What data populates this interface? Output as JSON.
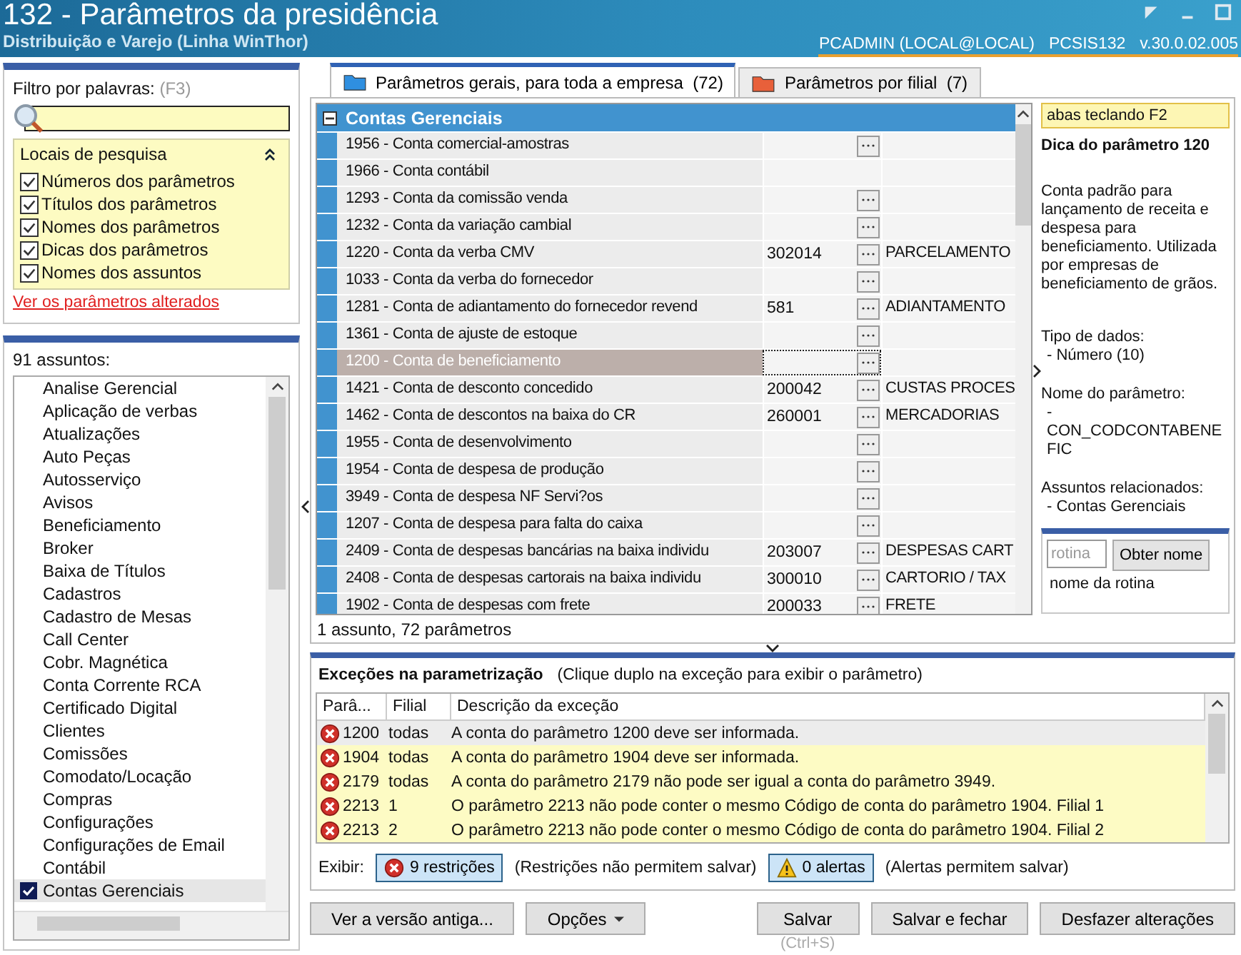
{
  "window": {
    "title": "132 - Parâmetros da presidência",
    "subtitle": "Distribuição e Varejo (Linha WinThor)",
    "user": "PCADMIN (LOCAL@LOCAL)",
    "program": "PCSIS132",
    "version": "v.30.0.02.005"
  },
  "filter": {
    "label": "Filtro por palavras:",
    "shortcut": "(F3)",
    "places": {
      "title": "Locais de pesquisa",
      "expanded": true,
      "options": [
        {
          "label": "Números dos parâmetros",
          "checked": true
        },
        {
          "label": "Títulos dos parâmetros",
          "checked": true
        },
        {
          "label": "Nomes dos parâmetros",
          "checked": true
        },
        {
          "label": "Dicas dos parâmetros",
          "checked": true
        },
        {
          "label": "Nomes dos assuntos",
          "checked": true
        }
      ]
    },
    "link": "Ver os parâmetros alterados"
  },
  "subjects": {
    "count_label": "91 assuntos:",
    "items": [
      {
        "label": "Analise Gerencial",
        "checked": false
      },
      {
        "label": "Aplicação de verbas",
        "checked": false
      },
      {
        "label": "Atualizações",
        "checked": false
      },
      {
        "label": "Auto Peças",
        "checked": false
      },
      {
        "label": "Autosserviço",
        "checked": false
      },
      {
        "label": "Avisos",
        "checked": false
      },
      {
        "label": "Beneficiamento",
        "checked": false
      },
      {
        "label": "Broker",
        "checked": false
      },
      {
        "label": "Baixa de Títulos",
        "checked": false
      },
      {
        "label": "Cadastros",
        "checked": false
      },
      {
        "label": "Cadastro de Mesas",
        "checked": false
      },
      {
        "label": "Call Center",
        "checked": false
      },
      {
        "label": "Cobr. Magnética",
        "checked": false
      },
      {
        "label": "Conta Corrente RCA",
        "checked": false
      },
      {
        "label": "Certificado Digital",
        "checked": false
      },
      {
        "label": "Clientes",
        "checked": false
      },
      {
        "label": "Comissões",
        "checked": false
      },
      {
        "label": "Comodato/Locação",
        "checked": false
      },
      {
        "label": "Compras",
        "checked": false
      },
      {
        "label": "Configurações",
        "checked": false
      },
      {
        "label": "Configurações de Email",
        "checked": false
      },
      {
        "label": "Contábil",
        "checked": false
      },
      {
        "label": "Contas Gerenciais",
        "checked": true
      }
    ]
  },
  "tabs": [
    {
      "label": "Parâmetros gerais, para toda a empresa",
      "count": "(72)",
      "selected": true,
      "color": "#2f8fe0"
    },
    {
      "label": "Parâmetros por filial",
      "count": "(7)",
      "selected": false,
      "color": "#e8603a"
    }
  ],
  "grid": {
    "group": "Contas Gerenciais",
    "expanded": true,
    "rows": [
      {
        "name": "1956 - Conta comercial-amostras",
        "button": true,
        "selected": false
      },
      {
        "name": "1966 - Conta contábil",
        "button": false,
        "selected": false
      },
      {
        "name": "1293 - Conta da comissão venda",
        "button": true,
        "selected": false
      },
      {
        "name": "1232 - Conta da variação cambial",
        "button": true,
        "selected": false
      },
      {
        "name": "1220 - Conta da verba CMV",
        "value": "302014",
        "button": true,
        "description": "PARCELAMENTO",
        "selected": false
      },
      {
        "name": "1033 - Conta da verba do fornecedor",
        "button": true,
        "selected": false
      },
      {
        "name": "1281 - Conta de adiantamento do fornecedor revend",
        "value": "581",
        "button": true,
        "description": "ADIANTAMENTO",
        "selected": false
      },
      {
        "name": "1361 - Conta de ajuste de estoque",
        "button": true,
        "selected": false
      },
      {
        "name": "1200 - Conta de beneficiamento",
        "button": true,
        "selected": true
      },
      {
        "name": "1421 - Conta de desconto concedido",
        "value": "200042",
        "button": true,
        "description": "CUSTAS PROCES",
        "selected": false
      },
      {
        "name": "1462 - Conta de descontos na baixa do CR",
        "value": "260001",
        "button": true,
        "description": "MERCADORIAS",
        "selected": false
      },
      {
        "name": "1955 - Conta de desenvolvimento",
        "button": true,
        "selected": false
      },
      {
        "name": "1954 - Conta de despesa de produção",
        "button": true,
        "selected": false
      },
      {
        "name": "3949 - Conta de despesa NF Servi?os",
        "button": true,
        "selected": false
      },
      {
        "name": "1207 - Conta de despesa para falta do caixa",
        "button": true,
        "selected": false
      },
      {
        "name": "2409 - Conta de despesas bancárias na baixa individu",
        "value": "203007",
        "button": true,
        "description": "DESPESAS CART",
        "selected": false
      },
      {
        "name": "2408 - Conta de despesas cartorais na baixa individu",
        "value": "300010",
        "button": true,
        "description": "CARTORIO / TAX",
        "selected": false
      },
      {
        "name": "1902 - Conta de despesas com frete",
        "value": "200033",
        "button": true,
        "description": "FRETE",
        "selected": false
      }
    ],
    "summary": "1 assunto, 72 parâmetros"
  },
  "hint": {
    "banner": "abas teclando F2",
    "title": "Dica do parâmetro 120",
    "description": "Conta padrão para lançamento de receita e despesa para beneficiamento. Utilizada por empresas de beneficiamento de grãos.",
    "sections": [
      {
        "heading": "Tipo de dados:",
        "value": "- Número (10)"
      },
      {
        "heading": "Nome do parâmetro:",
        "value": "- CON_CODCONTABENEFIC"
      },
      {
        "heading": "Assuntos relacionados:",
        "value": "- Contas Gerenciais"
      }
    ]
  },
  "routine": {
    "placeholder": "rotina",
    "button": "Obter nome",
    "result": "nome da rotina"
  },
  "exceptions": {
    "title": "Exceções na parametrização",
    "note": "(Clique duplo na exceção para exibir o parâmetro)",
    "columns": [
      "Parâ...",
      "Filial",
      "Descrição da exceção"
    ],
    "rows": [
      {
        "kind": "error",
        "param": "1200",
        "branch": "todas",
        "description": "A conta do parâmetro 1200 deve ser informada.",
        "selected": true
      },
      {
        "kind": "error",
        "param": "1904",
        "branch": "todas",
        "description": "A conta do parâmetro 1904 deve ser informada.",
        "selected": false
      },
      {
        "kind": "error",
        "param": "2179",
        "branch": "todas",
        "description": "A conta do parâmetro 2179 não pode ser igual a conta do parâmetro 3949.",
        "selected": false
      },
      {
        "kind": "error",
        "param": "2213",
        "branch": "1",
        "description": "O parâmetro 2213 não pode conter o mesmo Código de conta do parâmetro 1904. Filial 1",
        "selected": false
      },
      {
        "kind": "error",
        "param": "2213",
        "branch": "2",
        "description": "O parâmetro 2213 não pode conter o mesmo Código de conta do parâmetro 1904. Filial 2",
        "selected": false
      }
    ],
    "show_label": "Exibir:",
    "toggles": [
      {
        "kind": "error",
        "label": "9 restrições",
        "on": true,
        "note": "(Restrições não permitem salvar)"
      },
      {
        "kind": "warning",
        "label": "0 alertas",
        "on": true,
        "note": "(Alertas permitem salvar)"
      }
    ]
  },
  "buttons": [
    {
      "label": "Ver a versão antiga...",
      "kind": "plain"
    },
    {
      "label": "Opções",
      "kind": "menu"
    },
    {
      "label": "Salvar",
      "kind": "plain",
      "shortcut": "(Ctrl+S)"
    },
    {
      "label": "Salvar e fechar",
      "kind": "plain"
    },
    {
      "label": "Desfazer alterações",
      "kind": "plain"
    }
  ]
}
